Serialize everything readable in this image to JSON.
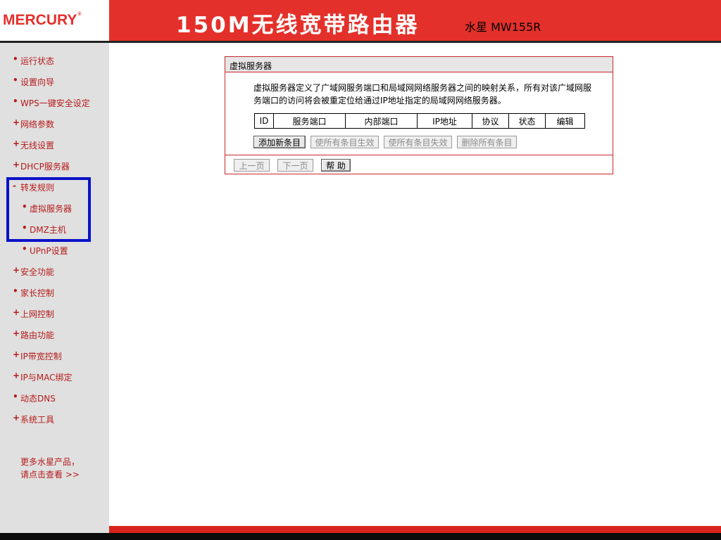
{
  "header": {
    "logo": "MERCURY",
    "logo_mark": "®",
    "title": "150M无线宽带路由器",
    "model": "水星 MW155R",
    "brand_color": "#e4302a"
  },
  "sidebar": {
    "items": [
      {
        "bullet": "•",
        "label": "运行状态"
      },
      {
        "bullet": "•",
        "label": "设置向导"
      },
      {
        "bullet": "•",
        "label": "WPS一键安全设定"
      },
      {
        "bullet": "+",
        "label": "网络参数"
      },
      {
        "bullet": "+",
        "label": "无线设置"
      },
      {
        "bullet": "+",
        "label": "DHCP服务器"
      },
      {
        "bullet": "-",
        "label": "转发规则"
      },
      {
        "bullet": "•",
        "label": "虚拟服务器"
      },
      {
        "bullet": "•",
        "label": "DMZ主机"
      },
      {
        "bullet": "•",
        "label": "UPnP设置"
      },
      {
        "bullet": "+",
        "label": "安全功能"
      },
      {
        "bullet": "•",
        "label": "家长控制"
      },
      {
        "bullet": "+",
        "label": "上网控制"
      },
      {
        "bullet": "+",
        "label": "路由功能"
      },
      {
        "bullet": "+",
        "label": "IP带宽控制"
      },
      {
        "bullet": "+",
        "label": "IP与MAC绑定"
      },
      {
        "bullet": "•",
        "label": "动态DNS"
      },
      {
        "bullet": "+",
        "label": "系统工具"
      }
    ],
    "more_line1": "更多水星产品，",
    "more_line2": "请点击查看 >>",
    "highlight_color": "#0a12c8"
  },
  "panel": {
    "title": "虚拟服务器",
    "description": "虚拟服务器定义了广域网服务端口和局域网网络服务器之间的映射关系，所有对该广域网服务端口的访问将会被重定位给通过IP地址指定的局域网网络服务器。",
    "table_headers": [
      "ID",
      "服务端口",
      "内部端口",
      "IP地址",
      "协议",
      "状态",
      "编辑"
    ],
    "buttons": {
      "add": "添加新条目",
      "enable_all": "使所有条目生效",
      "disable_all": "使所有条目失效",
      "delete_all": "删除所有条目"
    },
    "nav_buttons": {
      "prev": "上一页",
      "next": "下一页",
      "help": "帮 助"
    }
  }
}
